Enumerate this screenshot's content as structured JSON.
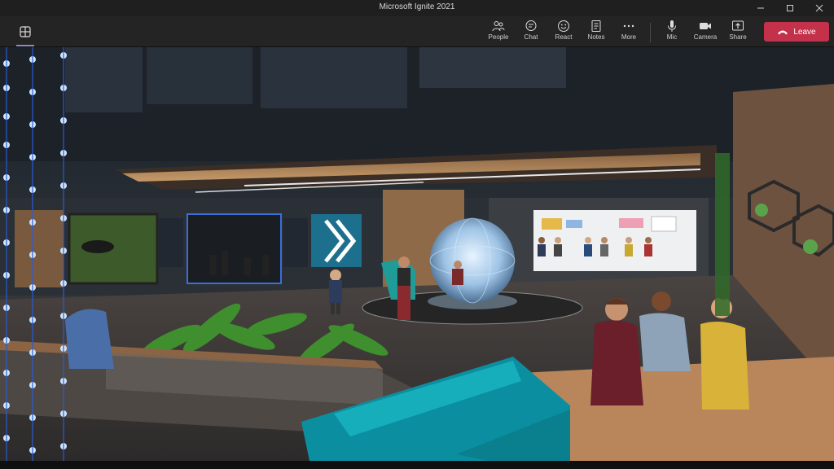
{
  "window": {
    "title": "Microsoft Ignite 2021"
  },
  "toolbar": {
    "items": [
      {
        "label": "People",
        "icon": "people-icon"
      },
      {
        "label": "Chat",
        "icon": "chat-icon"
      },
      {
        "label": "React",
        "icon": "react-icon"
      },
      {
        "label": "Notes",
        "icon": "notes-icon"
      },
      {
        "label": "More",
        "icon": "more-icon"
      },
      {
        "label": "Mic",
        "icon": "mic-icon"
      },
      {
        "label": "Camera",
        "icon": "camera-icon"
      },
      {
        "label": "Share",
        "icon": "share-icon"
      }
    ],
    "leave_label": "Leave"
  },
  "colors": {
    "leave": "#c4314b",
    "toolbar": "#242424",
    "titlebar": "#1f1f1f",
    "accent": "#8b8cc7"
  }
}
